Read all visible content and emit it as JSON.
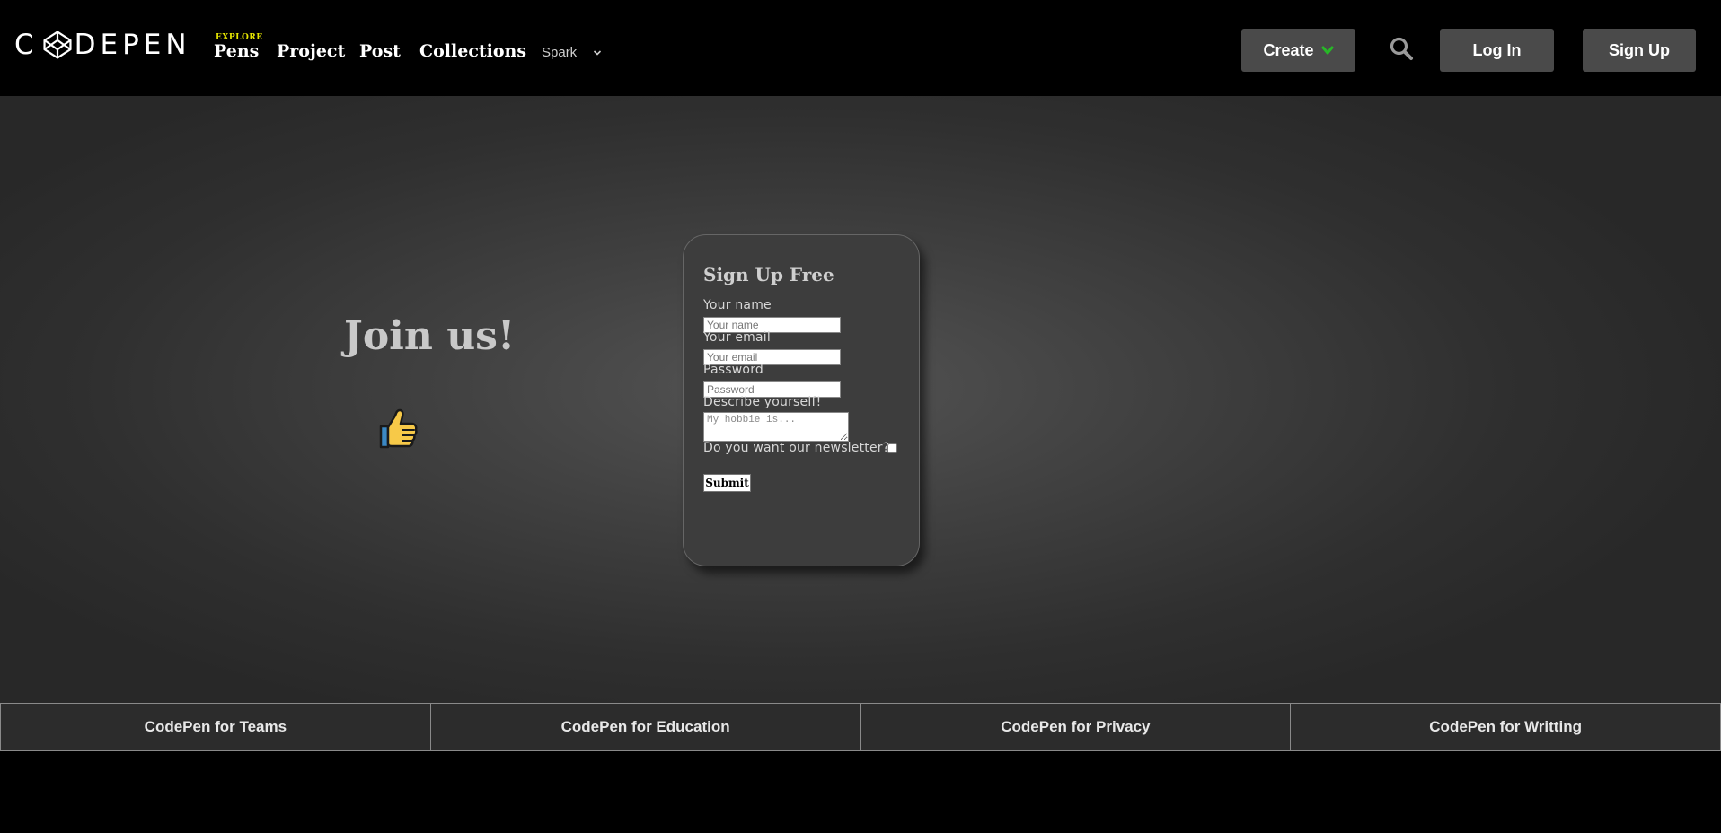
{
  "header": {
    "logo_text": "CODEPEN",
    "explore_badge": "EXPLORE",
    "nav": [
      {
        "label": "Pens"
      },
      {
        "label": "Project"
      },
      {
        "label": "Post"
      },
      {
        "label": "Collections"
      }
    ],
    "spark_label": "Spark",
    "create_label": "Create",
    "login_label": "Log In",
    "signup_label": "Sign Up",
    "accent_color": "#27b827",
    "explore_color": "#e6e600"
  },
  "main": {
    "join_title": "Join us!",
    "thumb_icon": "thumbs-up-icon"
  },
  "form": {
    "title": "Sign Up Free",
    "name_label": "Your name",
    "name_placeholder": "Your name",
    "email_label": "Your email",
    "email_placeholder": "Your email",
    "password_label": "Password",
    "password_placeholder": "Password",
    "describe_label": "Describe yourself!",
    "describe_placeholder": "My hobbie is...",
    "newsletter_label": "Do you want our newsletter?",
    "newsletter_checked": false,
    "submit_label": "Submit"
  },
  "footer": {
    "links": [
      {
        "label": "CodePen for Teams"
      },
      {
        "label": "CodePen for Education"
      },
      {
        "label": "CodePen for Privacy"
      },
      {
        "label": "CodePen for Writting"
      }
    ]
  }
}
